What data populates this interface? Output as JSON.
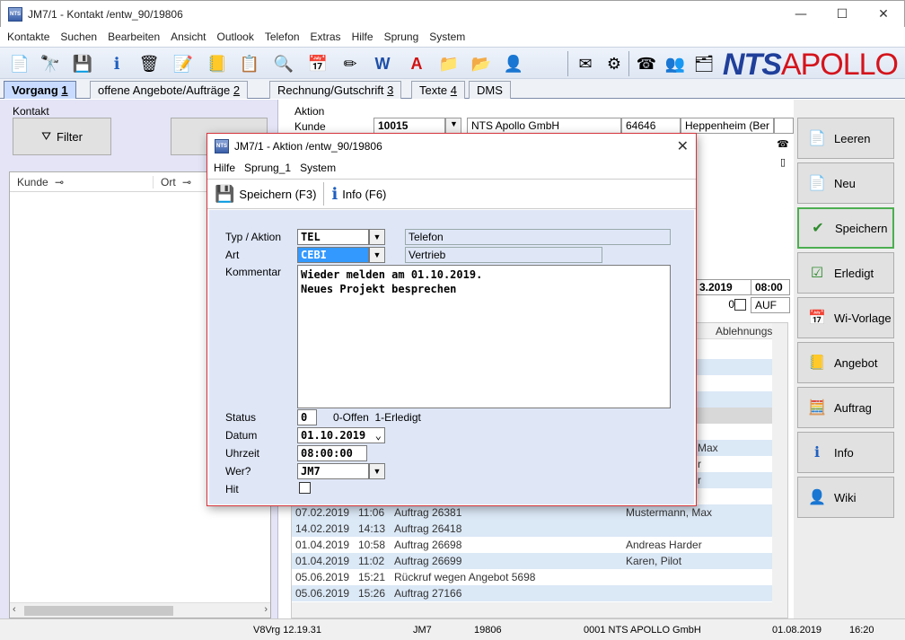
{
  "window": {
    "title": "JM7/1 - Kontakt /entw_90/19806",
    "minimize": "—",
    "maximize": "☐",
    "close": "✕"
  },
  "menu": [
    "Kontakte",
    "Suchen",
    "Bearbeiten",
    "Ansicht",
    "Outlook",
    "Telefon",
    "Extras",
    "Hilfe",
    "Sprung",
    "System"
  ],
  "brand": {
    "nts": "NTS",
    "apollo": "APOLLO"
  },
  "tabs": [
    {
      "label": "Vorgang",
      "num": "1"
    },
    {
      "label": "offene Angebote/Aufträge",
      "num": "2"
    },
    {
      "label": "Rechnung/Gutschrift",
      "num": "3"
    },
    {
      "label": "Texte",
      "num": "4"
    },
    {
      "label": "DMS",
      "num": ""
    }
  ],
  "left": {
    "section_label": "Kontakt",
    "filter_label": "Filter",
    "columns": [
      "Kunde",
      "Ort"
    ]
  },
  "center": {
    "aktion_label": "Aktion",
    "kunde_label": "Kunde",
    "kunde_nr": "10015",
    "firma": "NTS Apollo GmbH",
    "plz": "64646",
    "ort": "Heppenheim (Ber",
    "date_partial": "3.2019",
    "time": "08:00",
    "count": "0",
    "auf": "AUF",
    "ablehnung_header": "Ablehnungs",
    "partial_rows": [
      {
        "right": "Max"
      },
      {
        "right": "r"
      },
      {
        "right": "r"
      }
    ],
    "rows": [
      {
        "date": "07.02.2019",
        "time": "11:06",
        "text": "Auftrag 26381",
        "person": "Mustermann, Max"
      },
      {
        "date": "14.02.2019",
        "time": "14:13",
        "text": "Auftrag 26418",
        "person": ""
      },
      {
        "date": "01.04.2019",
        "time": "10:58",
        "text": "Auftrag 26698",
        "person": "Andreas Harder"
      },
      {
        "date": "01.04.2019",
        "time": "11:02",
        "text": "Auftrag 26699",
        "person": "Karen, Pilot"
      },
      {
        "date": "05.06.2019",
        "time": "15:21",
        "text": "Rückruf wegen Angebot 5698",
        "person": ""
      },
      {
        "date": "05.06.2019",
        "time": "15:26",
        "text": "Auftrag 27166",
        "person": ""
      }
    ]
  },
  "right_buttons": [
    "Leeren",
    "Neu",
    "Speichern",
    "Erledigt",
    "Wi-Vorlage",
    "Angebot",
    "Auftrag",
    "Info",
    "Wiki"
  ],
  "status": {
    "version": "V8Vrg 12.19.31",
    "user": "JM7",
    "id": "19806",
    "company": "0001 NTS APOLLO GmbH",
    "date": "01.08.2019",
    "time": "16:20"
  },
  "dialog": {
    "title": "JM7/1 - Aktion /entw_90/19806",
    "menu": [
      "Hilfe",
      "Sprung_1",
      "System"
    ],
    "save_label": "Speichern (F3)",
    "info_label": "Info (F6)",
    "fields": {
      "typ_label": "Typ / Aktion",
      "typ_value": "TEL",
      "typ_desc": "Telefon",
      "art_label": "Art",
      "art_value": "CEBI",
      "art_desc": "Vertrieb",
      "kommentar_label": "Kommentar",
      "kommentar_line1": "Wieder melden am 01.10.2019.",
      "kommentar_line2": "Neues Projekt besprechen",
      "status_label": "Status",
      "status_value": "0",
      "status_hint": "0-Offen  1-Erledigt",
      "datum_label": "Datum",
      "datum_value": "01.10.2019",
      "uhrzeit_label": "Uhrzeit",
      "uhrzeit_value": "08:00:00",
      "wer_label": "Wer?",
      "wer_value": "JM7",
      "hit_label": "Hit"
    }
  }
}
